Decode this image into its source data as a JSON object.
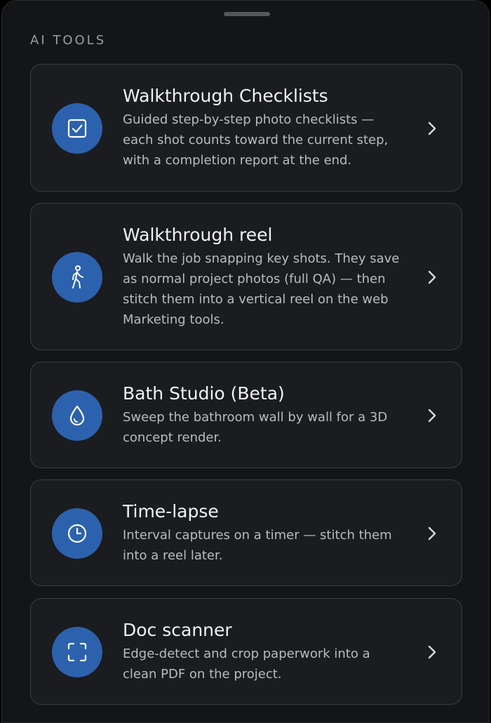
{
  "section_label": "AI TOOLS",
  "accent_color": "#2c62ad",
  "tools": [
    {
      "icon": "checkbox-icon",
      "title": "Walkthrough Checklists",
      "description": "Guided step-by-step photo checklists — each shot counts toward the current step, with a completion report at the end."
    },
    {
      "icon": "walking-person-icon",
      "title": "Walkthrough reel",
      "description": "Walk the job snapping key shots. They save as normal project photos (full QA) — then stitch them into a vertical reel on the web Marketing tools."
    },
    {
      "icon": "water-drop-icon",
      "title": "Bath Studio (Beta)",
      "description": "Sweep the bathroom wall by wall for a 3D concept render."
    },
    {
      "icon": "clock-icon",
      "title": "Time-lapse",
      "description": "Interval captures on a timer — stitch them into a reel later."
    },
    {
      "icon": "scan-frame-icon",
      "title": "Doc scanner",
      "description": "Edge-detect and crop paperwork into a clean PDF on the project."
    }
  ]
}
